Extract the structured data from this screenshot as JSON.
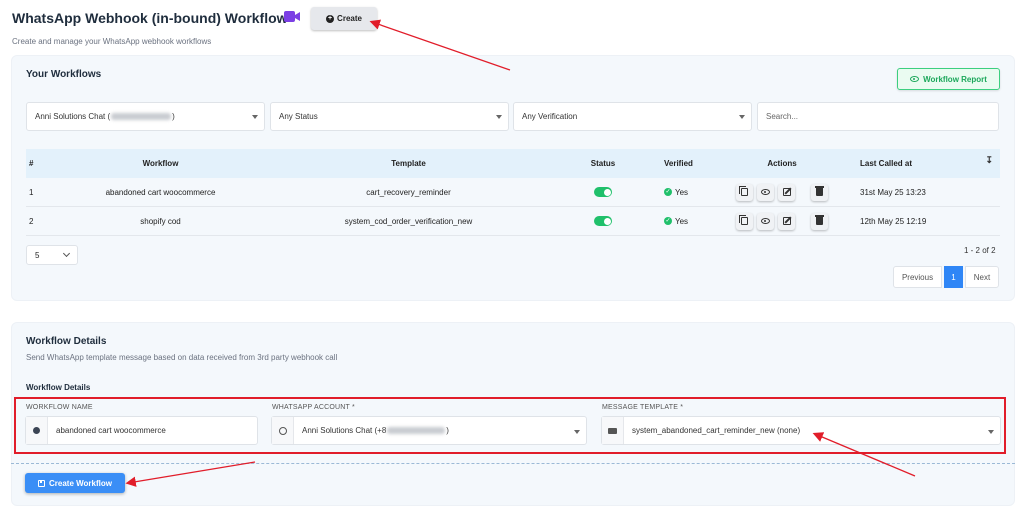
{
  "header": {
    "title": "WhatsApp Webhook (in-bound) Workflow",
    "create_label": "Create",
    "subtitle": "Create and manage your WhatsApp webhook workflows",
    "video_icon": "video-camera-icon",
    "accent_color": "#7b3fe4"
  },
  "workflows": {
    "title": "Your Workflows",
    "report_label": "Workflow Report",
    "filters": {
      "account_prefix": "Anni Solutions Chat (",
      "account_suffix": ")",
      "status": "Any Status",
      "verification": "Any Verification",
      "search_placeholder": "Search..."
    },
    "columns": [
      "#",
      "Workflow",
      "Template",
      "Status",
      "Verified",
      "Actions",
      "Last Called at"
    ],
    "rows": [
      {
        "num": "1",
        "workflow": "abandoned cart woocommerce",
        "template": "cart_recovery_reminder",
        "verified": "Yes",
        "last_called": "31st May 25 13:23"
      },
      {
        "num": "2",
        "workflow": "shopify cod",
        "template": "system_cod_order_verification_new",
        "verified": "Yes",
        "last_called": "12th May 25 12:19"
      }
    ],
    "page_size": "5",
    "count_text": "1 - 2 of 2",
    "pagination": {
      "prev": "Previous",
      "current": "1",
      "next": "Next"
    },
    "status_color": "#20c06b"
  },
  "details": {
    "title": "Workflow Details",
    "subtitle": "Send WhatsApp template message based on data received from 3rd party webhook call",
    "section_label": "Workflow Details",
    "fields": {
      "name_label": "WORKFLOW NAME",
      "name_value": "abandoned cart woocommerce",
      "account_label": "WHATSAPP ACCOUNT *",
      "account_value_prefix": "Anni Solutions Chat (+8",
      "account_value_suffix": ")",
      "template_label": "MESSAGE TEMPLATE *",
      "template_value": "system_abandoned_cart_reminder_new (none)"
    },
    "submit_label": "Create Workflow",
    "highlight_color": "#e11d2a"
  }
}
